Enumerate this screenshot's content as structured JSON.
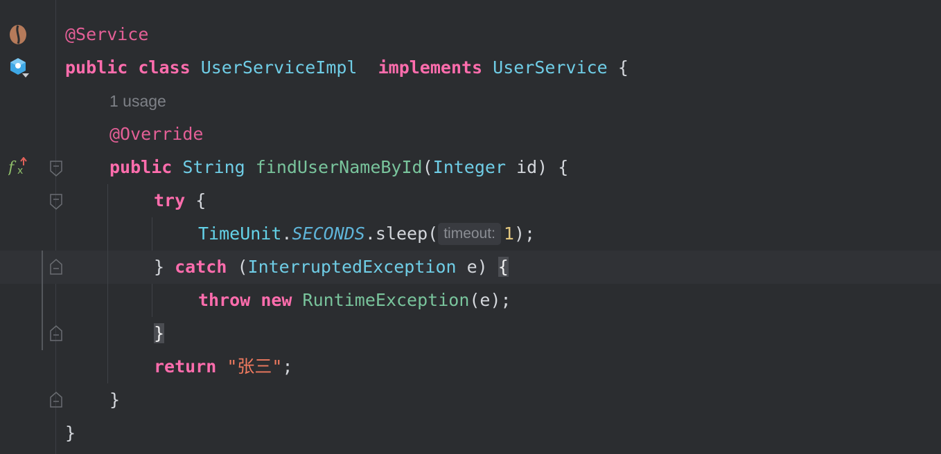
{
  "editor": {
    "language": "Java",
    "lines": {
      "l1": "@Service",
      "l2_kw1": "public",
      "l2_kw2": "class",
      "l2_name": "UserServiceImpl",
      "l2_kw3": "implements",
      "l2_iface": "UserService",
      "l2_brace": "{",
      "usage_hint": "1 usage",
      "l4": "@Override",
      "l5_kw": "public",
      "l5_type": "String",
      "l5_method": "findUserNameById",
      "l5_paren_open": "(",
      "l5_param_type": "Integer",
      "l5_param": "id",
      "l5_close": ") {",
      "l6_kw": "try",
      "l6_brace": "{",
      "l7_class": "TimeUnit",
      "l7_dot1": ".",
      "l7_field": "SECONDS",
      "l7_method": ".sleep(",
      "l7_hint": "timeout:",
      "l7_num": "1",
      "l7_end": ");",
      "l8_close": "}",
      "l8_kw": "catch",
      "l8_open": "(",
      "l8_type": "InterruptedException",
      "l8_param": "e)",
      "l8_brace": "{",
      "l9_kw1": "throw",
      "l9_kw2": "new",
      "l9_type": "RuntimeException",
      "l9_end": "(e);",
      "l10_brace": "}",
      "l11_kw": "return",
      "l11_str": "\"张三\"",
      "l11_end": ";",
      "l12_brace": "}",
      "l13_brace": "}"
    },
    "gutter_icons": [
      "spring-bean-icon",
      "implement-interface-icon",
      "override-method-icon"
    ],
    "colors": {
      "background": "#2b2d30",
      "current_line": "#303236",
      "keyword": "#ff6dad",
      "annotation": "#e35f96",
      "type": "#6fcde6",
      "method": "#79c49c",
      "string": "#f07a5f",
      "number": "#e2c77f"
    }
  }
}
